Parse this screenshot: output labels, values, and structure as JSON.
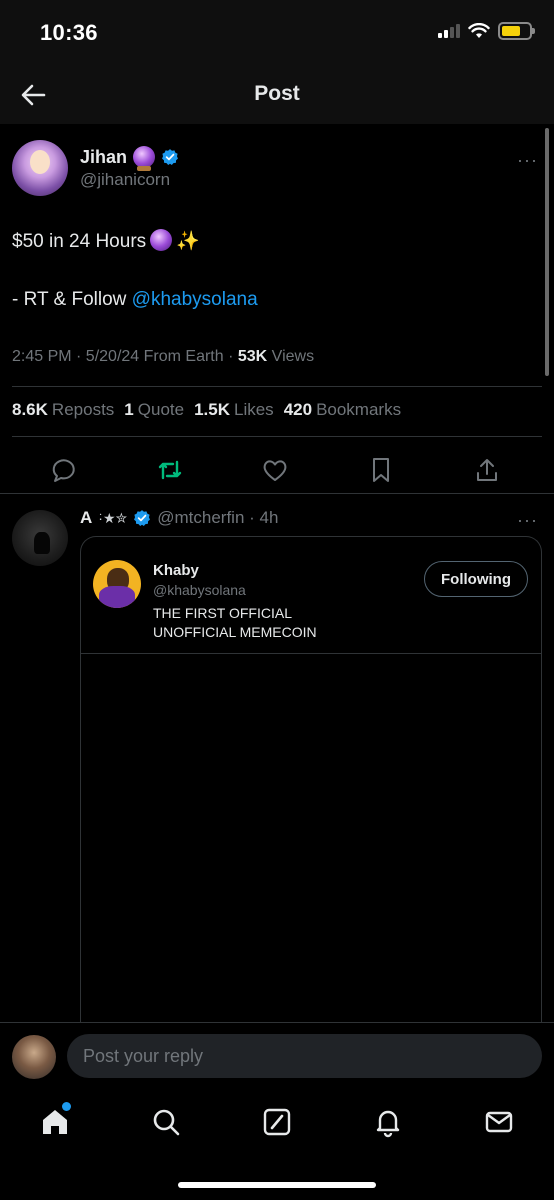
{
  "status_bar": {
    "time": "10:36"
  },
  "header": {
    "title": "Post"
  },
  "post": {
    "author_name": "Jihan",
    "author_handle": "@jihanicorn",
    "text_line1": "$50 in 24 Hours",
    "text_line2_prefix": "- RT & Follow ",
    "text_line2_mention": "@khabysolana",
    "meta_time": "2:45 PM · 5/20/24 From Earth · ",
    "meta_views_count": "53K",
    "meta_views_label": " Views",
    "more": "···"
  },
  "stats": [
    {
      "count": "8.6K",
      "label": "Reposts"
    },
    {
      "count": "1",
      "label": "Quote"
    },
    {
      "count": "1.5K",
      "label": "Likes"
    },
    {
      "count": "420",
      "label": "Bookmarks"
    }
  ],
  "actions": {
    "reply_icon": "reply-icon",
    "repost_icon": "repost-icon",
    "repost_active_color": "#00ba7c",
    "like_icon": "heart-icon",
    "bookmark_icon": "bookmark-icon",
    "share_icon": "share-icon"
  },
  "reply": {
    "name": "A",
    "stars": "͘·★✮",
    "handle_time": "@mtcherfin · 4h",
    "more": "···",
    "embed": {
      "name": "Khaby",
      "handle": "@khabysolana",
      "bio": "THE FIRST OFFICIAL UNOFFICIAL MEMECOIN",
      "follow_label": "Following"
    }
  },
  "composer": {
    "placeholder": "Post your reply"
  },
  "nav": [
    "home-icon",
    "search-icon",
    "grok-icon",
    "notifications-icon",
    "messages-icon"
  ],
  "colors": {
    "accent": "#1d9bf0",
    "background": "#000000",
    "muted": "#71767b"
  }
}
